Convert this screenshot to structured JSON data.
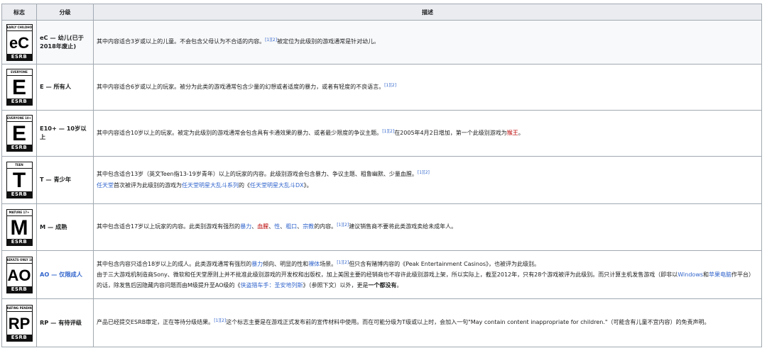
{
  "headers": {
    "mark": "标志",
    "rating": "分级",
    "desc": "描述"
  },
  "logos": {
    "ec": {
      "top": "EARLY CHILDHOOD",
      "letter": "eC",
      "bottom": "ESRB"
    },
    "e": {
      "top": "EVERYONE",
      "letter": "E",
      "bottom": "ESRB"
    },
    "e10": {
      "top": "EVERYONE 10+",
      "letter": "E",
      "bottom": "ESRB"
    },
    "t": {
      "top": "TEEN",
      "letter": "T",
      "bottom": "ESRB"
    },
    "m": {
      "top": "MATURE 17+",
      "letter": "M",
      "bottom": "ESRB"
    },
    "ao": {
      "top": "ADULTS ONLY 18+",
      "letter": "AO",
      "bottom": "ESRB"
    },
    "rp": {
      "top": "RATING PENDING",
      "letter": "RP",
      "bottom": "ESRB"
    }
  },
  "rows": {
    "ec": {
      "rating_line1": "eC — 幼儿(已于",
      "rating_line2": "2018年废止)",
      "desc_a": "其中内容适合3岁或以上的儿童。不会包含父母认为不合适的内容。",
      "ref": "[1][2]",
      "desc_b": "被定位为此级别的游戏通常是针对幼儿。"
    },
    "e": {
      "rating": "E — 所有人",
      "desc_a": "其中内容适合6岁或以上的玩家。被分为此类的游戏通常包含少量的幻想或者适度的暴力，或者有轻度的不良语言。",
      "ref": "[1][2]"
    },
    "e10": {
      "rating": "E10+ — 10岁以上",
      "desc_a": "其中内容适合10岁以上的玩家。被定为此级别的游戏通常会包含具有卡通效果的暴力、或者最少限度的争议主题。",
      "ref": "[1][2]",
      "desc_b": "在2005年4月2日增加，第一个此级别游戏为",
      "desc_link": "猴王",
      "desc_c": "。"
    },
    "t": {
      "rating": "T — 青少年",
      "desc_a": "其中包含适合13岁（英文Teen指13-19岁青年）以上的玩家的内容。此级别游戏会包含暴力、争议主题、粗鲁幽默、少量血腥。",
      "ref": "[1][2]",
      "line2_link1": "任天堂",
      "line2_a": "首次被评为此级别的游戏为",
      "line2_link2": "任天堂明星大乱斗系列",
      "line2_b": "的《",
      "line2_link3": "任天堂明星大乱斗DX",
      "line2_c": "》。"
    },
    "m": {
      "rating": "M — 成熟",
      "desc_a": "其中包含适合17岁以上玩家的内容。此类别游戏有强烈的",
      "w1": "暴力",
      "sep1": "、",
      "w2": "血腥",
      "sep2": "、",
      "w3": "性",
      "sep3": "、",
      "w4": "粗口",
      "sep4": "、",
      "w5": "宗教",
      "desc_b": "的内容。",
      "ref": "[1][2]",
      "desc_c": "建议销售商不要将此类游戏卖给未成年人。"
    },
    "ao": {
      "rating": "AO — 仅限成人",
      "desc_a": "其中包含内容只适合18岁以上的成人。此类游戏通常有强烈的",
      "w1": "暴力",
      "desc_b": "倾向、明显的性和",
      "w2": "裸体",
      "desc_c": "场景。",
      "ref": "[1][2]",
      "desc_d": "但只含有赌博内容的《Peak Entertainment Casinos》，也被评为此级别。",
      "p2_a": "由于三大游戏机制造商Sony、微软和任天堂原则上并不批准此级别游戏的开发权和出版权，加上美国主要的经销商也不容许此级别游戏上架，所以实际上，截至2012年，只有28个游戏被评为此级别。而只计算主机发售游戏（即非以",
      "p2_link1": "Windows",
      "p2_b": "和",
      "p2_link2": "苹果电脑",
      "p2_c": "作平台）的话，除发售后因隐藏内容问题而由M级提升至AO级的《",
      "p2_link3": "侠盗猎车手：圣安地列斯",
      "p2_d": "》（参照下文）以外，更是",
      "p2_bold": "一个都没有",
      "p2_e": "。"
    },
    "rp": {
      "rating": "RP — 有待评级",
      "desc_a": "产品已经提交ESRB审定，正在等待分级结果。",
      "ref": "[1][2]",
      "desc_b": "这个标志主要是在游戏正式发布前的宣传材料中使用。而在可能分级为T级或以上时，会加入一句\"May contain content inappropriate for children.\"（可能含有儿童不宜内容）的免责声明。"
    }
  }
}
